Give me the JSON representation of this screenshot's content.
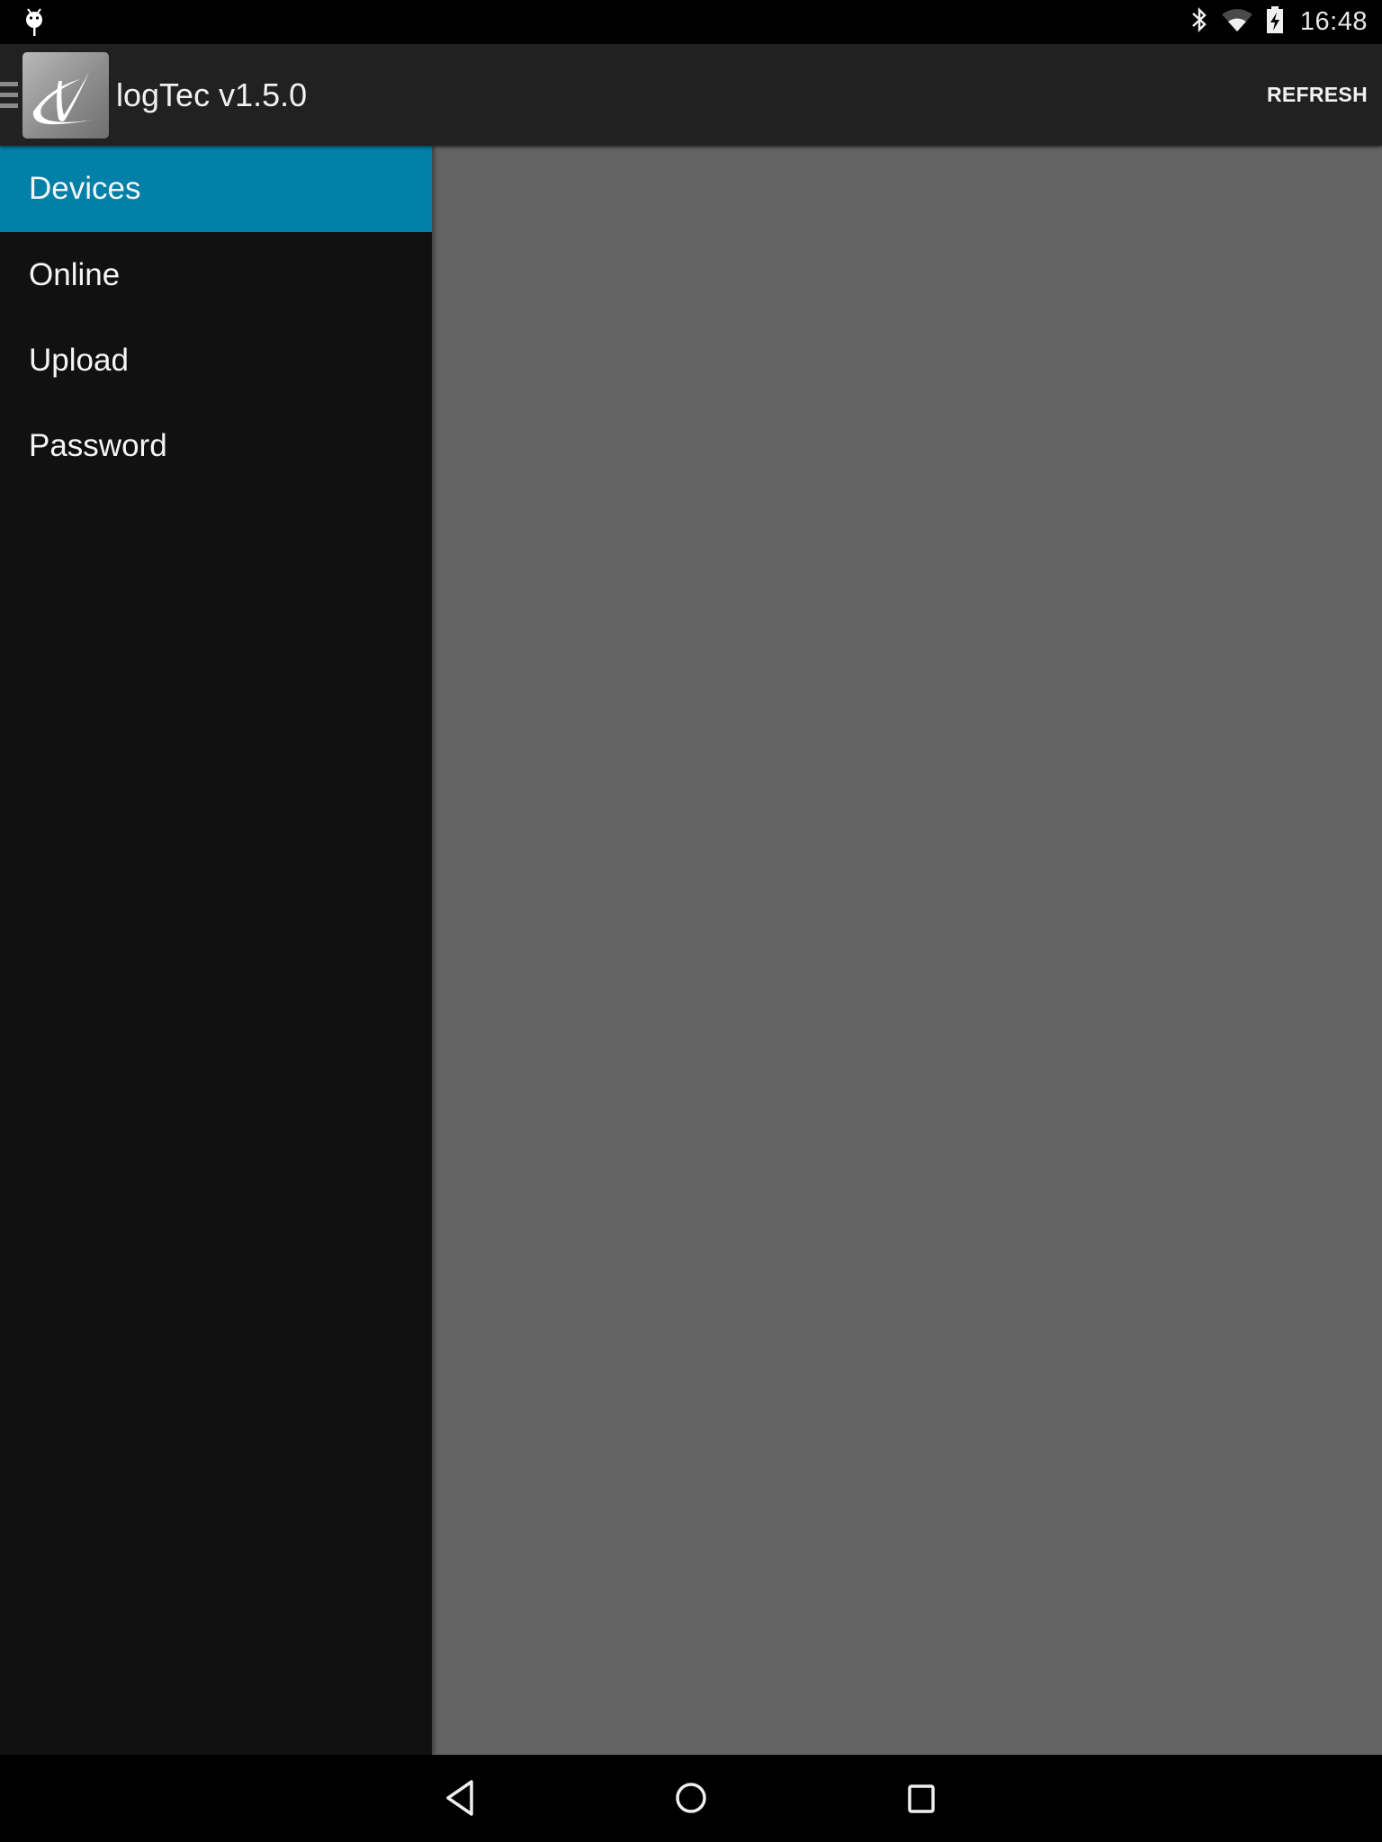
{
  "status_bar": {
    "notification_icon": "android-debug-icon",
    "icons": [
      "bluetooth-icon",
      "wifi-icon",
      "battery-charging-icon"
    ],
    "time": "16:48"
  },
  "action_bar": {
    "menu_icon": "hamburger-icon",
    "logo_icon": "logtec-logo-icon",
    "title": "logTec v1.5.0",
    "refresh_label": "REFRESH"
  },
  "drawer": {
    "items": [
      {
        "label": "Devices",
        "selected": true
      },
      {
        "label": "Online",
        "selected": false
      },
      {
        "label": "Upload",
        "selected": false
      },
      {
        "label": "Password",
        "selected": false
      }
    ]
  },
  "colors": {
    "accent": "#0280a8",
    "action_bar": "#212121",
    "drawer_bg": "#111111",
    "content_bg": "#636363"
  },
  "nav_bar": {
    "buttons": [
      "back-icon",
      "home-icon",
      "recents-icon"
    ]
  }
}
